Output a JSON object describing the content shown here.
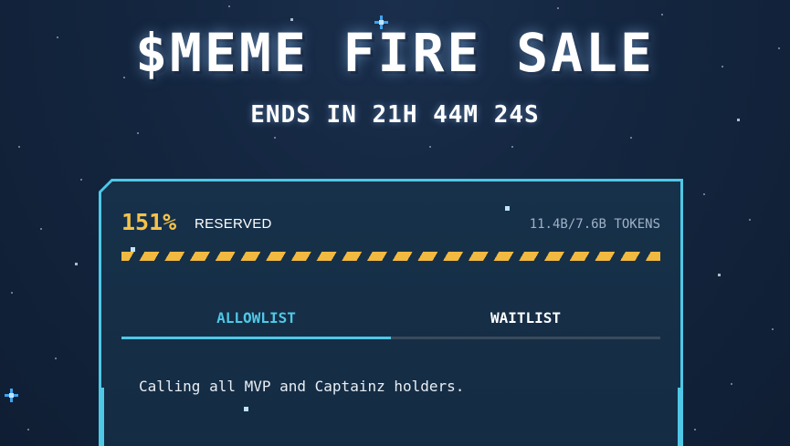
{
  "sale": {
    "title": "$MEME FIRE SALE",
    "countdown": "ENDS IN 21H 44M 24S"
  },
  "reservation": {
    "percent_label": "151%",
    "reserved_label": "RESERVED",
    "tokens_label": "11.4B/7.6B TOKENS",
    "progress_fraction": 1.0
  },
  "tabs": [
    {
      "label": "ALLOWLIST",
      "active": true
    },
    {
      "label": "WAITLIST",
      "active": false
    }
  ],
  "panel": {
    "message": "Calling all MVP and Captainz holders."
  },
  "colors": {
    "accent": "#4fc8e6",
    "highlight": "#f5c24a",
    "background": "#142640"
  }
}
